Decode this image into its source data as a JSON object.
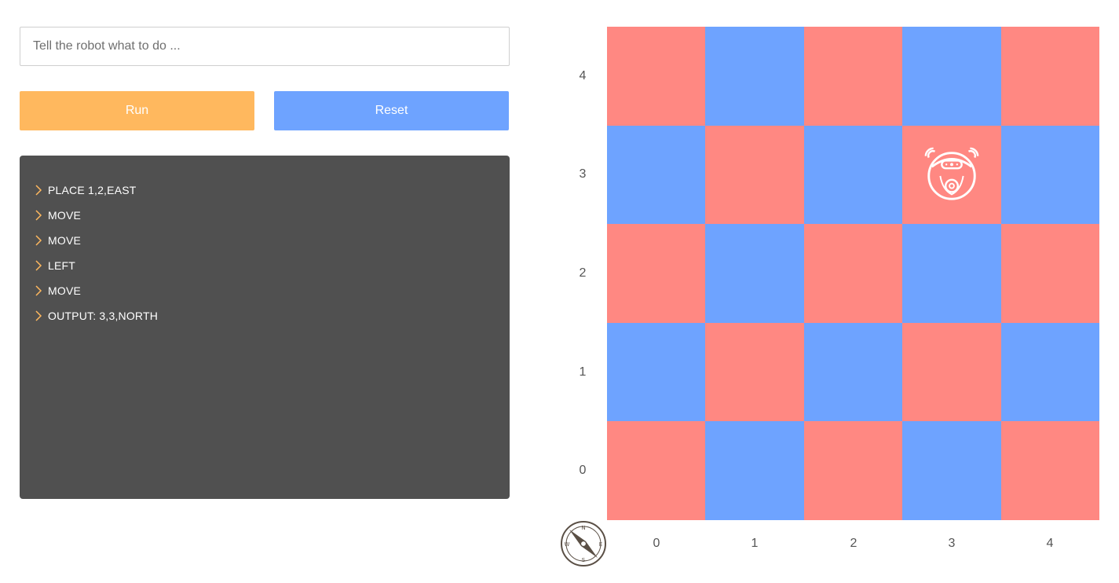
{
  "input": {
    "placeholder": "Tell the robot what to do ...",
    "value": ""
  },
  "buttons": {
    "run_label": "Run",
    "reset_label": "Reset"
  },
  "log": [
    "PLACE 1,2,EAST",
    "MOVE",
    "MOVE",
    "LEFT",
    "MOVE",
    "OUTPUT: 3,3,NORTH"
  ],
  "board": {
    "size": 5,
    "x_labels": [
      "0",
      "1",
      "2",
      "3",
      "4"
    ],
    "y_labels": [
      "4",
      "3",
      "2",
      "1",
      "0"
    ],
    "robot": {
      "x": 3,
      "y": 3,
      "facing": "NORTH",
      "icon": "robot-vacuum-icon"
    },
    "colors": {
      "red": "#ff8882",
      "blue": "#6ea3ff"
    }
  },
  "compass": {
    "n": "N",
    "s": "S",
    "e": "E",
    "w": "W",
    "icon": "compass-icon"
  },
  "colors": {
    "run": "#ffb85e",
    "reset": "#6ea3ff",
    "console": "#505050"
  }
}
